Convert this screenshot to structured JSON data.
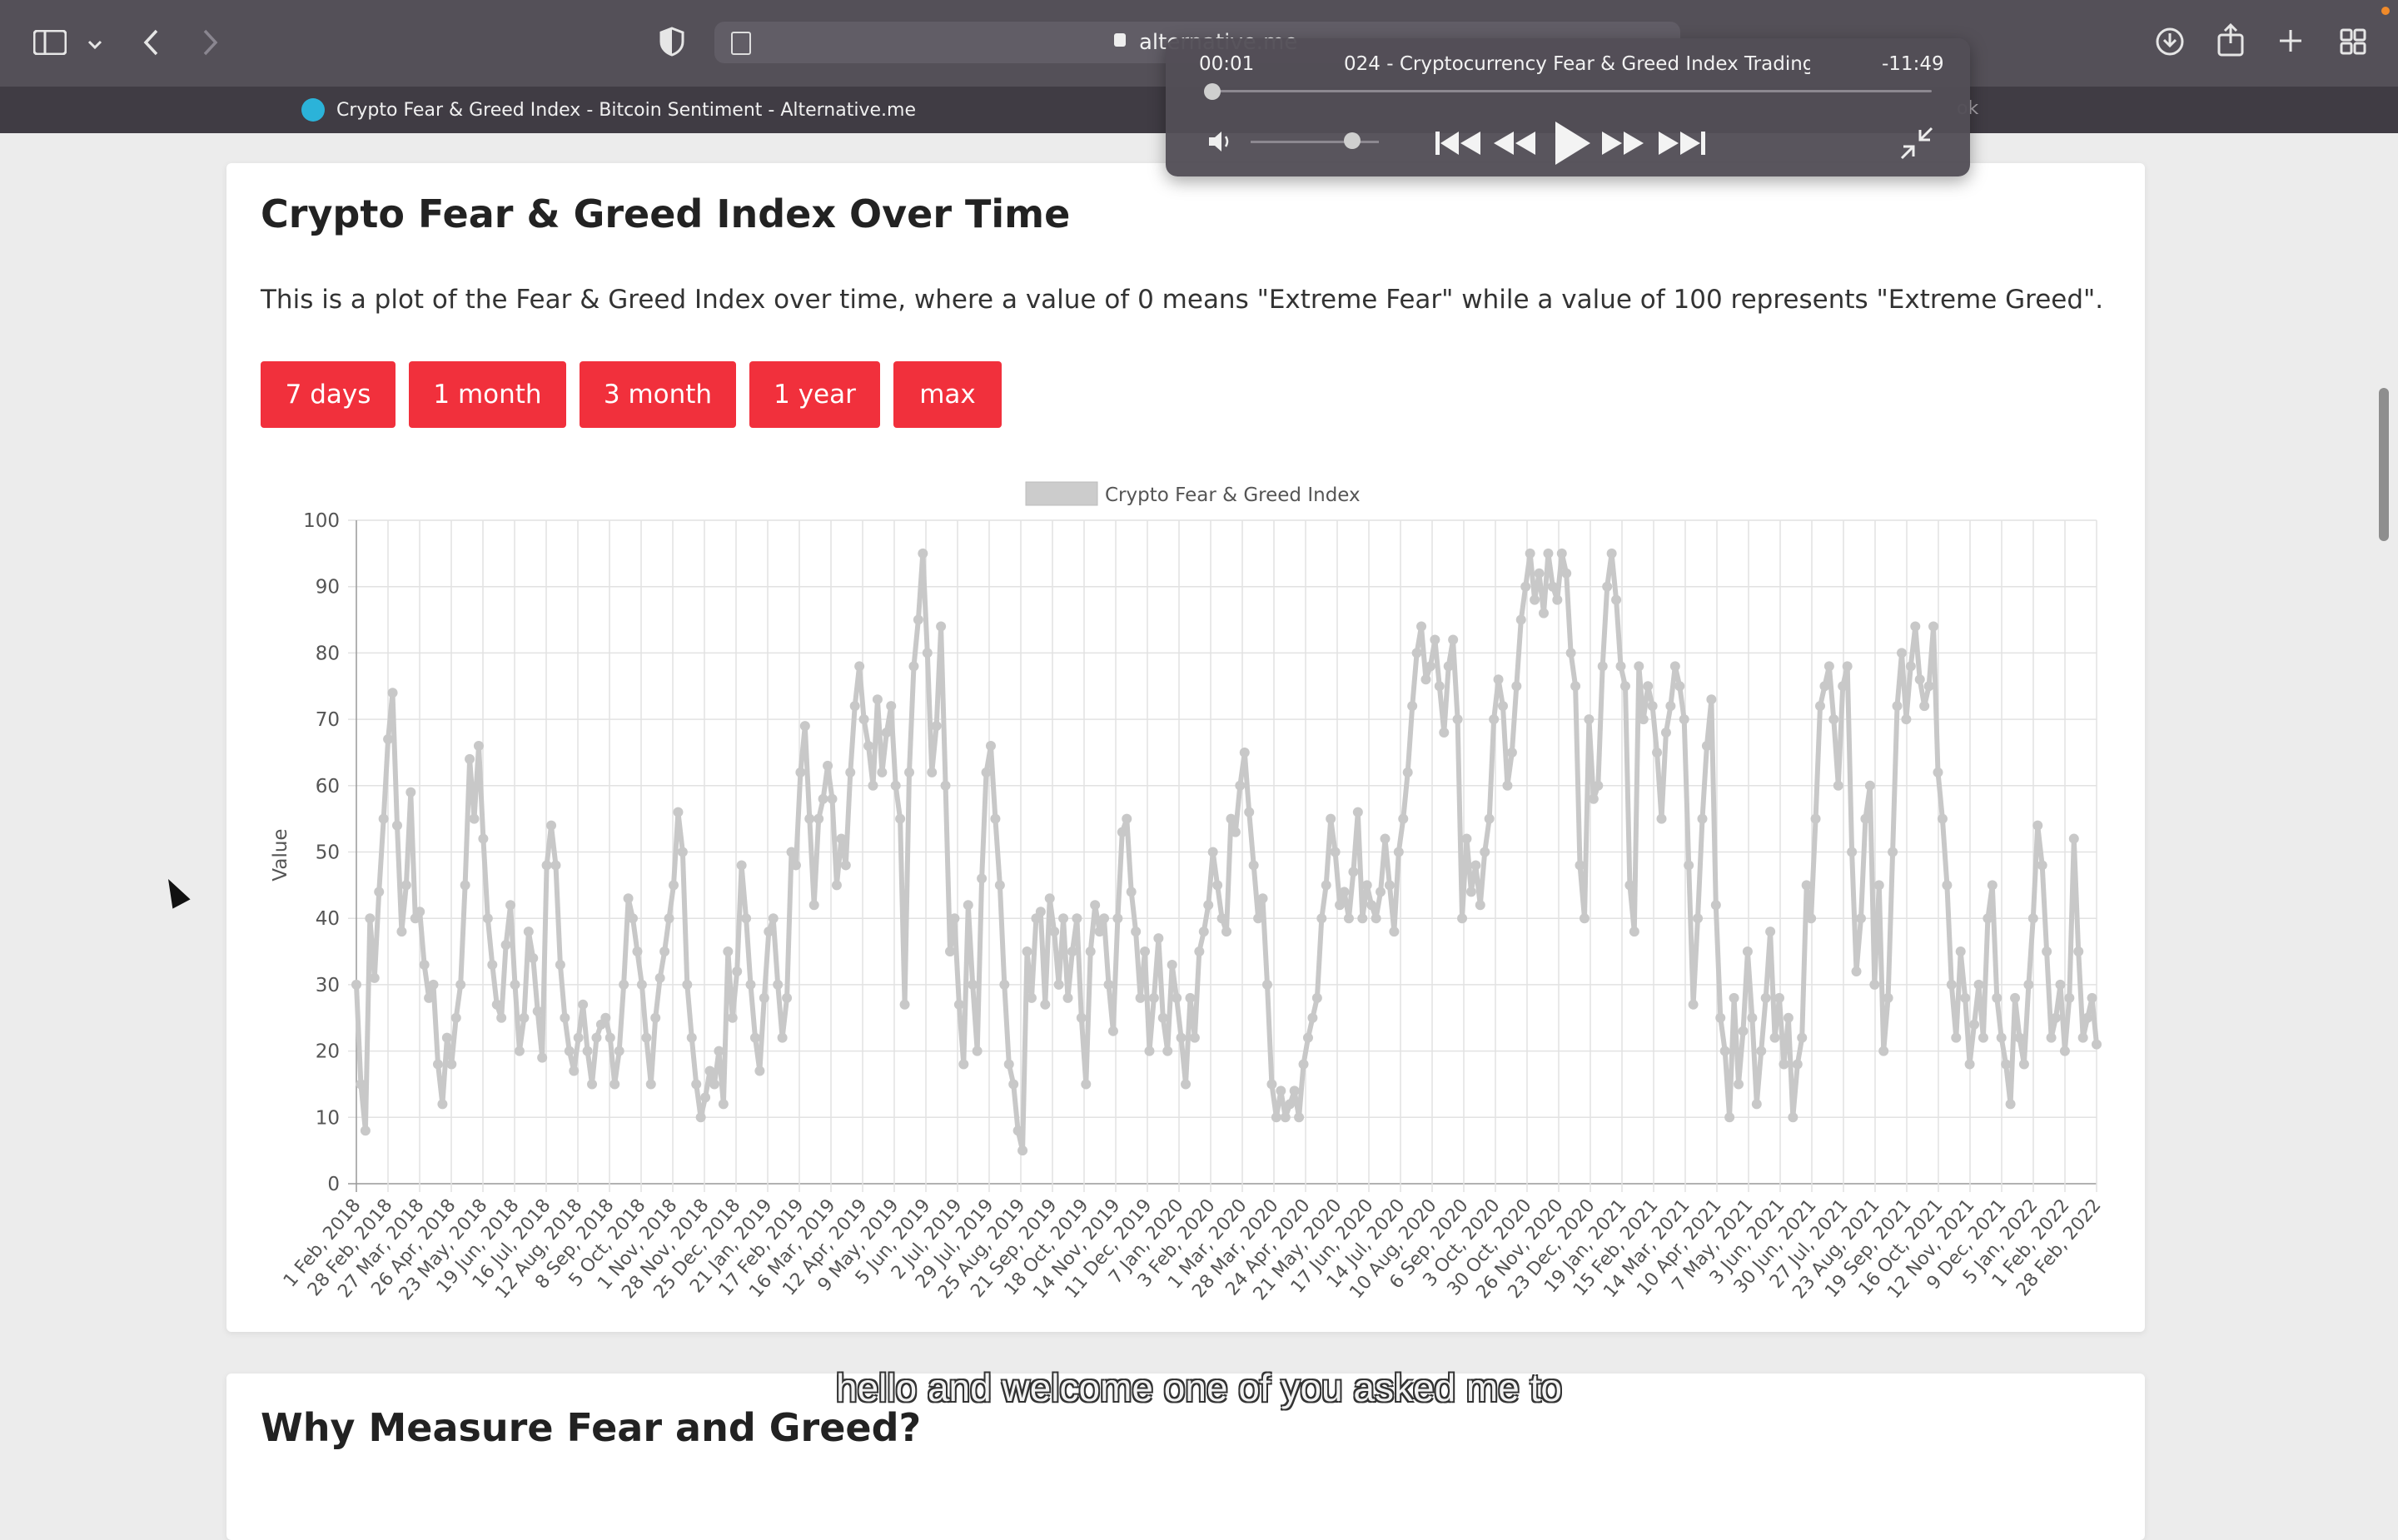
{
  "browser": {
    "url": "alternative.me",
    "tab_title": "Crypto Fear & Greed Index - Bitcoin Sentiment - Alternative.me",
    "tab2_fragment": "ok"
  },
  "player": {
    "elapsed": "00:01",
    "remaining": "-11:49",
    "title": "024 - Cryptocurrency Fear & Greed Index Trading...",
    "progress": 0.0,
    "volume": 0.8
  },
  "section1": {
    "title": "Crypto Fear & Greed Index Over Time",
    "description": "This is a plot of the Fear & Greed Index over time, where a value of 0 means \"Extreme Fear\" while a value of 100 represents \"Extreme Greed\".",
    "ranges": [
      "7 days",
      "1 month",
      "3 month",
      "1 year",
      "max"
    ]
  },
  "section2": {
    "title": "Why Measure Fear and Greed?"
  },
  "subtitle": "hello and welcome one of you asked me to",
  "colors": {
    "accent": "#f1303c",
    "series": "#c8c8c8",
    "toolbar": "#545058"
  },
  "chart_data": {
    "type": "line",
    "legend": "Crypto Fear & Greed Index",
    "legend_position": "top-center",
    "ylabel": "Value",
    "ylim": [
      0,
      100
    ],
    "yticks": [
      0,
      10,
      20,
      30,
      40,
      50,
      60,
      70,
      80,
      90,
      100
    ],
    "grid": true,
    "xtick_labels": [
      "1 Feb, 2018",
      "28 Feb, 2018",
      "27 Mar, 2018",
      "26 Apr, 2018",
      "23 May, 2018",
      "19 Jun, 2018",
      "16 Jul, 2018",
      "12 Aug, 2018",
      "8 Sep, 2018",
      "5 Oct, 2018",
      "1 Nov, 2018",
      "28 Nov, 2018",
      "25 Dec, 2018",
      "21 Jan, 2019",
      "17 Feb, 2019",
      "16 Mar, 2019",
      "12 Apr, 2019",
      "9 May, 2019",
      "5 Jun, 2019",
      "2 Jul, 2019",
      "29 Jul, 2019",
      "25 Aug, 2019",
      "21 Sep, 2019",
      "18 Oct, 2019",
      "14 Nov, 2019",
      "11 Dec, 2019",
      "7 Jan, 2020",
      "3 Feb, 2020",
      "1 Mar, 2020",
      "28 Mar, 2020",
      "24 Apr, 2020",
      "21 May, 2020",
      "17 Jun, 2020",
      "14 Jul, 2020",
      "10 Aug, 2020",
      "6 Sep, 2020",
      "3 Oct, 2020",
      "30 Oct, 2020",
      "26 Nov, 2020",
      "23 Dec, 2020",
      "19 Jan, 2021",
      "15 Feb, 2021",
      "14 Mar, 2021",
      "10 Apr, 2021",
      "7 May, 2021",
      "3 Jun, 2021",
      "30 Jun, 2021",
      "27 Jul, 2021",
      "23 Aug, 2021",
      "19 Sep, 2021",
      "16 Oct, 2021",
      "12 Nov, 2021",
      "9 Dec, 2021",
      "5 Jan, 2022",
      "1 Feb, 2022",
      "28 Feb, 2022"
    ],
    "values": [
      30,
      15,
      8,
      40,
      31,
      44,
      55,
      67,
      74,
      54,
      38,
      45,
      59,
      40,
      41,
      33,
      28,
      30,
      18,
      12,
      22,
      18,
      25,
      30,
      45,
      64,
      55,
      66,
      52,
      40,
      33,
      27,
      25,
      36,
      42,
      30,
      20,
      25,
      38,
      34,
      26,
      19,
      48,
      54,
      48,
      33,
      25,
      20,
      17,
      22,
      27,
      20,
      15,
      22,
      24,
      25,
      22,
      15,
      20,
      30,
      43,
      40,
      35,
      30,
      22,
      15,
      25,
      31,
      35,
      40,
      45,
      56,
      50,
      30,
      22,
      15,
      10,
      13,
      17,
      15,
      20,
      12,
      35,
      25,
      32,
      48,
      40,
      30,
      22,
      17,
      28,
      38,
      40,
      30,
      22,
      28,
      50,
      48,
      62,
      69,
      55,
      42,
      55,
      58,
      63,
      58,
      45,
      52,
      48,
      62,
      72,
      78,
      70,
      66,
      60,
      73,
      62,
      68,
      72,
      60,
      55,
      27,
      62,
      78,
      85,
      95,
      80,
      62,
      69,
      84,
      60,
      35,
      40,
      27,
      18,
      42,
      30,
      20,
      46,
      62,
      66,
      55,
      45,
      30,
      18,
      15,
      8,
      5,
      35,
      28,
      40,
      41,
      27,
      43,
      38,
      30,
      40,
      28,
      35,
      40,
      25,
      15,
      35,
      42,
      38,
      40,
      30,
      23,
      40,
      53,
      55,
      44,
      38,
      28,
      35,
      20,
      28,
      37,
      25,
      20,
      33,
      28,
      22,
      15,
      28,
      22,
      35,
      38,
      42,
      50,
      45,
      40,
      38,
      55,
      53,
      60,
      65,
      56,
      48,
      40,
      43,
      30,
      15,
      10,
      14,
      10,
      12,
      14,
      10,
      18,
      22,
      25,
      28,
      40,
      45,
      55,
      50,
      42,
      44,
      40,
      47,
      56,
      40,
      45,
      42,
      40,
      44,
      52,
      45,
      38,
      50,
      55,
      62,
      72,
      80,
      84,
      76,
      78,
      82,
      75,
      68,
      78,
      82,
      70,
      40,
      52,
      44,
      48,
      42,
      50,
      55,
      70,
      76,
      72,
      60,
      65,
      75,
      85,
      90,
      95,
      88,
      92,
      86,
      95,
      90,
      88,
      95,
      92,
      80,
      75,
      48,
      40,
      70,
      58,
      60,
      78,
      90,
      95,
      88,
      78,
      75,
      45,
      38,
      78,
      70,
      75,
      72,
      65,
      55,
      68,
      72,
      78,
      75,
      70,
      48,
      27,
      40,
      55,
      66,
      73,
      42,
      25,
      20,
      10,
      28,
      15,
      23,
      35,
      25,
      12,
      20,
      28,
      38,
      22,
      28,
      18,
      25,
      10,
      18,
      22,
      45,
      40,
      55,
      72,
      75,
      78,
      70,
      60,
      75,
      78,
      50,
      32,
      40,
      55,
      60,
      30,
      45,
      20,
      28,
      50,
      72,
      80,
      70,
      78,
      84,
      76,
      72,
      75,
      84,
      62,
      55,
      45,
      30,
      22,
      35,
      28,
      18,
      24,
      30,
      22,
      40,
      45,
      28,
      22,
      18,
      12,
      28,
      22,
      18,
      30,
      40,
      54,
      48,
      35,
      22,
      25,
      30,
      20,
      28,
      52,
      35,
      22,
      25,
      28,
      21
    ]
  }
}
